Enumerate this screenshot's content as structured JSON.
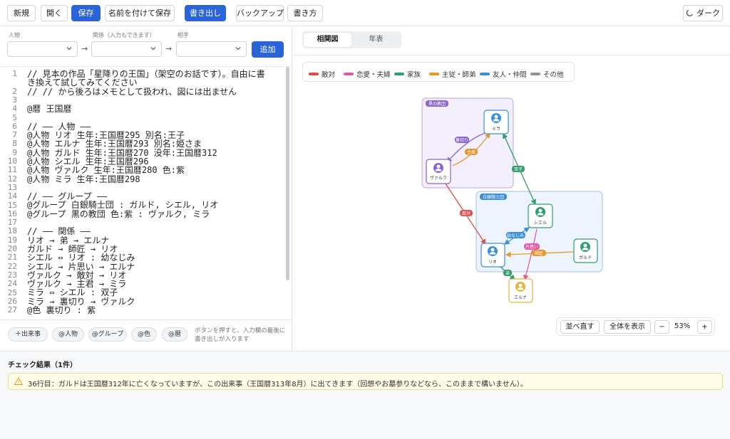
{
  "toolbar": {
    "new": "新規",
    "open": "開く",
    "save": "保存",
    "save_as": "名前を付けて保存",
    "export": "書き出し",
    "backup": "バックアップ",
    "write_style": "書き方",
    "dark": "ダーク"
  },
  "relation_form": {
    "person_label": "人物",
    "relation_label": "関係（入力もできます）",
    "partner_label": "相手",
    "arrow": "→",
    "add": "追加"
  },
  "editor": {
    "line_numbers": [
      "1",
      "2",
      "3",
      "4",
      "5",
      "6",
      "7",
      "8",
      "9",
      "10",
      "11",
      "12",
      "13",
      "14",
      "15",
      "16",
      "17",
      "18",
      "19",
      "20",
      "21",
      "22",
      "23",
      "24",
      "25",
      "26",
      "27",
      "28"
    ],
    "lines": [
      "// 見本の作品「星降りの王国」（架空のお話です）。自由に書",
      "き換えて試してみてください",
      "// // から後ろはメモとして扱われ、図には出ません",
      "",
      "@暦 王国暦",
      "",
      "// ―― 人物 ――",
      "@人物 リオ 生年:王国暦295 別名:王子",
      "@人物 エルナ 生年:王国暦293 別名:姫さま",
      "@人物 ガルド 生年:王国暦270 没年:王国暦312",
      "@人物 シエル 生年:王国暦296",
      "@人物 ヴァルク 生年:王国暦280 色:紫",
      "@人物 ミラ 生年:王国暦298",
      "",
      "// ―― グループ ――",
      "@グループ 白銀騎士団 : ガルド, シエル, リオ",
      "@グループ 黒の教団 色:紫 : ヴァルク, ミラ",
      "",
      "// ―― 関係 ――",
      "リオ → 弟 → エルナ",
      "ガルド → 師匠 → リオ",
      "シエル ⇔ リオ : 幼なじみ",
      "シエル → 片思い → エルナ",
      "ヴァルク → 敵対 → リオ",
      "ヴァルク → 主君 → ミラ",
      "ミラ ⇔ シエル : 双子",
      "ミラ → 裏切り → ヴァルク",
      "@色 裏切り : 紫"
    ]
  },
  "snippets": {
    "event": "＋出来事",
    "person": "@人物",
    "group": "@グループ",
    "color": "@色",
    "calendar": "@暦",
    "hint": "ボタンを押すと、入力欄の最後に書き出しが入ります"
  },
  "view_tabs": {
    "graph": "相関図",
    "timeline": "年表"
  },
  "legend": [
    {
      "label": "敵対",
      "color": "#e04b4b"
    },
    {
      "label": "恋愛・夫婦",
      "color": "#e05aa5"
    },
    {
      "label": "家族",
      "color": "#2f9e6b"
    },
    {
      "label": "主従・師弟",
      "color": "#e8962b"
    },
    {
      "label": "友人・仲間",
      "color": "#3b8fd9"
    },
    {
      "label": "その他",
      "color": "#8e939b"
    }
  ],
  "graph": {
    "groups": {
      "black": "黒の教団",
      "white": "白銀騎士団"
    },
    "nodes": {
      "mira": "ミラ",
      "valk": "ヴァルク",
      "ciel": "シエル",
      "rio": "リオ",
      "gald": "ガルド",
      "erna": "エルナ"
    },
    "edges": {
      "betray": "裏切り",
      "lord": "主君",
      "twins": "双子",
      "hostile": "敵対",
      "childhood": "幼なじみ",
      "crush": "片思い",
      "mentor": "師匠",
      "brother": "弟"
    }
  },
  "zoom": {
    "rearrange": "並べ直す",
    "fit": "全体を表示",
    "minus": "−",
    "value": "53%",
    "plus": "+"
  },
  "results": {
    "title": "チェック結果（1件）",
    "warning": "36行目：ガルドは王国暦312年に亡くなっていますが、この出来事（王国暦313年8月）に出てきます（回想やお墓参りなどなら、このままで構いません）。"
  }
}
